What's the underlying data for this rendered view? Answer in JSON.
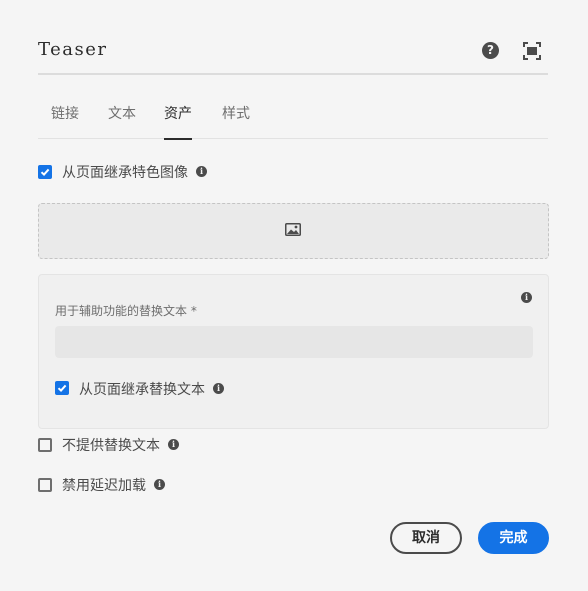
{
  "dialog": {
    "title": "Teaser",
    "help_icon": "help-icon",
    "fullscreen_icon": "fullscreen-icon"
  },
  "tabs": [
    {
      "label": "链接",
      "active": false
    },
    {
      "label": "文本",
      "active": false
    },
    {
      "label": "资产",
      "active": true
    },
    {
      "label": "样式",
      "active": false
    }
  ],
  "asset": {
    "inherit_image": {
      "label": "从页面继承特色图像",
      "checked": true
    },
    "dropzone_icon": "image-icon",
    "alt_text": {
      "label": "用于辅助功能的替换文本 *",
      "value": "",
      "inherit": {
        "label": "从页面继承替换文本",
        "checked": true
      }
    },
    "no_alt": {
      "label": "不提供替换文本",
      "checked": false
    },
    "disable_lazy": {
      "label": "禁用延迟加载",
      "checked": false
    }
  },
  "footer": {
    "cancel_label": "取消",
    "done_label": "完成"
  },
  "colors": {
    "accent": "#1473e6",
    "text": "#4b4b4b",
    "background": "#f5f5f5"
  }
}
